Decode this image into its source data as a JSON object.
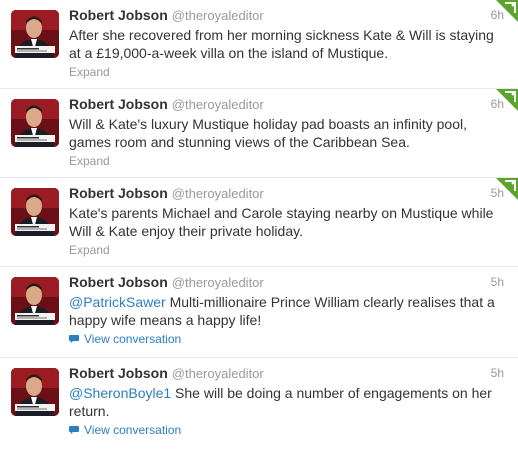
{
  "colors": {
    "link": "#2a7fbf",
    "muted": "#999999",
    "text": "#333333",
    "retweet_corner": "#5aa52c",
    "avatar_bg": "#6b1016"
  },
  "tweets": [
    {
      "fullname": "Robert Jobson",
      "username": "@theroyaleditor",
      "time": "6h",
      "mention": "",
      "text": "After she recovered from her morning sickness Kate & Will is staying at a £19,000-a-week villa on the island of Mustique.",
      "action": "Expand",
      "action_icon": "",
      "corner_icon": "retweet-corner-icon"
    },
    {
      "fullname": "Robert Jobson",
      "username": "@theroyaleditor",
      "time": "6h",
      "mention": "",
      "text": "Will & Kate's luxury Mustique holiday pad boasts an infinity pool, games room and stunning views of the Caribbean Sea.",
      "action": "Expand",
      "action_icon": "",
      "corner_icon": "retweet-corner-icon"
    },
    {
      "fullname": "Robert Jobson",
      "username": "@theroyaleditor",
      "time": "5h",
      "mention": "",
      "text": "Kate's parents Michael and Carole staying nearby on Mustique while Will & Kate enjoy their private holiday.",
      "action": "Expand",
      "action_icon": "",
      "corner_icon": "retweet-corner-icon"
    },
    {
      "fullname": "Robert Jobson",
      "username": "@theroyaleditor",
      "time": "5h",
      "mention": "@PatrickSawer",
      "text": " Multi-millionaire Prince William clearly realises that a happy wife means a happy life!",
      "action": "View conversation",
      "action_icon": "speech-bubble-icon",
      "corner_icon": ""
    },
    {
      "fullname": "Robert Jobson",
      "username": "@theroyaleditor",
      "time": "5h",
      "mention": "@SheronBoyle1",
      "text": " She will be doing a number of engagements on her return.",
      "action": "View conversation",
      "action_icon": "speech-bubble-icon",
      "corner_icon": ""
    }
  ]
}
